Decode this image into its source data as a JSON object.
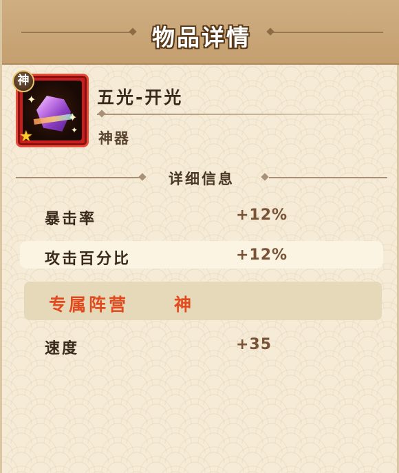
{
  "header": {
    "title": "物品详情"
  },
  "item": {
    "badge": "神",
    "name": "五光-开光",
    "category": "神器",
    "icon": "purple-gem-icon",
    "rarity_icon": "gold-star-icon"
  },
  "details": {
    "section_title": "详细信息",
    "stats": [
      {
        "label": "暴击率",
        "value": "+12%"
      },
      {
        "label": "攻击百分比",
        "value": "+12%"
      }
    ],
    "faction": {
      "label": "专属阵营",
      "value": "神"
    },
    "extra_stats": [
      {
        "label": "速度",
        "value": "+35"
      }
    ]
  },
  "colors": {
    "header_bg": "#c9a676",
    "panel_bg": "#f5ebd7",
    "faction_text": "#e04a1e",
    "stat_value": "#7a5236",
    "item_frame": "#c71f1f"
  }
}
